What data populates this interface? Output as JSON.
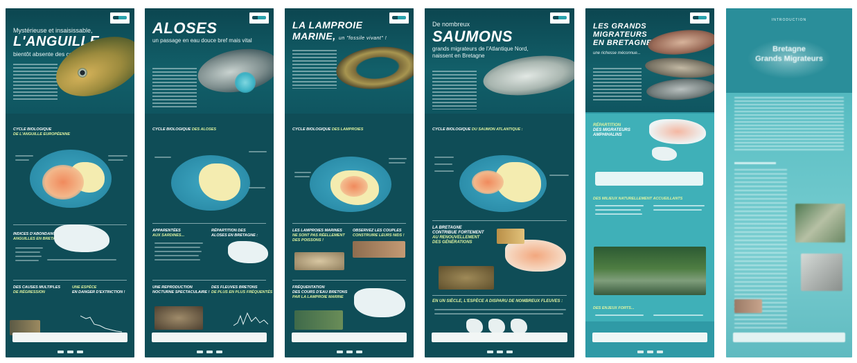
{
  "panels": [
    {
      "kicker": "Mystérieuse et insaisissable,",
      "title": "L'ANGUILLE",
      "subtitle": "bientôt absente des cours d'eau ?",
      "cycle_title_a": "CYCLE BIOLOGIQUE",
      "cycle_title_b": "DE L'ANGUILLE EUROPÉENNE",
      "index_title_a": "INDICES D'ABONDANCE",
      "index_title_b": "ANGUILLES EN BRETAGNE",
      "causes_title_a": "DES CAUSES MULTIPLES",
      "causes_title_b": "DE RÉGRESSION",
      "species_title_a": "UNE ESPÈCE",
      "species_title_b": "EN DANGER D'EXTINCTION !"
    },
    {
      "title": "ALOSES",
      "subtitle": "un passage en eau douce bref mais vital",
      "cycle_title_a": "CYCLE BIOLOGIQUE",
      "cycle_title_b": "DES ALOSES",
      "s1_a": "APPARENTÉES",
      "s1_b": "AUX SARDINES...",
      "s2_a": "RÉPARTITION DES",
      "s2_b": "ALOSES EN BRETAGNE :",
      "s3_a": "UNE REPRODUCTION",
      "s3_b": "NOCTURNE SPECTACULAIRE !",
      "s4_a": "DES FLEUVES BRETONS",
      "s4_b": "DE PLUS EN PLUS FRÉQUENTÉS"
    },
    {
      "title": "LA LAMPROIE",
      "title2": "MARINE,",
      "title_tail": "un \"fossile vivant\" !",
      "cycle_title_a": "CYCLE BIOLOGIQUE",
      "cycle_title_b": "DES LAMPROIES",
      "s1_a": "LES LAMPROIES MARINES",
      "s1_b": "NE SONT PAS RÉELLEMENT DES POISSONS !",
      "s2_a": "OBSERVEZ LES COUPLES",
      "s2_b": "CONSTRUIRE LEURS NIDS !",
      "s3_a": "FRÉQUENTATION",
      "s3_b": "DES COURS D'EAU BRETONS",
      "s3_c": "PAR LA LAMPROIE MARINE"
    },
    {
      "kicker": "De nombreux",
      "title": "SAUMONS",
      "subtitle": "grands migrateurs de l'Atlantique Nord, naissent en Bretagne",
      "cycle_title_a": "CYCLE BIOLOGIQUE",
      "cycle_title_b": "DU SAUMON ATLANTIQUE :",
      "s1_a": "LA BRETAGNE",
      "s1_b": "CONTRIBUE FORTEMENT",
      "s1_c": "AU RENOUVELLEMENT",
      "s1_d": "DES GÉNÉRATIONS",
      "s2": "EN UN SIÈCLE, L'ESPÈCE A DISPARU DE NOMBREUX FLEUVES :"
    },
    {
      "title_a": "LES GRANDS",
      "title_b": "MIGRATEURS",
      "title_c": "EN BRETAGNE,",
      "subtitle": "une richesse méconnue...",
      "s1_a": "RÉPARTITION",
      "s1_b": "DES MIGRATEURS",
      "s1_c": "AMPHIHALINS",
      "s2": "DES MILIEUX NATURELLEMENT ACCUEILLANTS",
      "s3": "DES ENJEUX FORTS..."
    },
    {
      "header": "INTRODUCTION",
      "title_a": "Bretagne",
      "title_b": "Grands Migrateurs"
    }
  ],
  "colors": {
    "panel_dark": "#0f4d57",
    "panel_teal": "#2f9aa6",
    "accent_yellow": "#dff3a0",
    "land": "#f4ecb0",
    "heat": "#f08a5d"
  }
}
